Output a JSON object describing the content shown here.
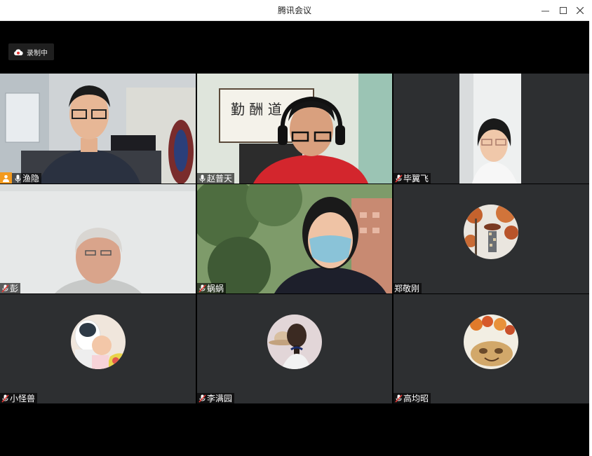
{
  "window": {
    "title": "腾讯会议"
  },
  "recording": {
    "label": "录制中"
  },
  "participants": [
    {
      "name": "渔隐",
      "host": true,
      "mic": "on",
      "video": true
    },
    {
      "name": "赵普天",
      "mic": "on",
      "video": true
    },
    {
      "name": "毕翼飞",
      "mic": "muted",
      "video": true
    },
    {
      "name": "彭",
      "mic": "muted",
      "video": true
    },
    {
      "name": "蜗蜗",
      "mic": "muted",
      "video": true
    },
    {
      "name": "郑敬刚",
      "mic": "none",
      "video": false
    },
    {
      "name": "小怪兽",
      "mic": "muted",
      "video": false
    },
    {
      "name": "李满园",
      "mic": "muted",
      "video": false
    },
    {
      "name": "高均昭",
      "mic": "muted",
      "video": false
    }
  ],
  "icons": {
    "minimize": "minimize-icon",
    "maximize": "maximize-icon",
    "close": "close-icon",
    "record": "cloud-record-icon",
    "mic": "mic-icon",
    "mic_muted": "mic-muted-icon",
    "host": "host-icon"
  }
}
